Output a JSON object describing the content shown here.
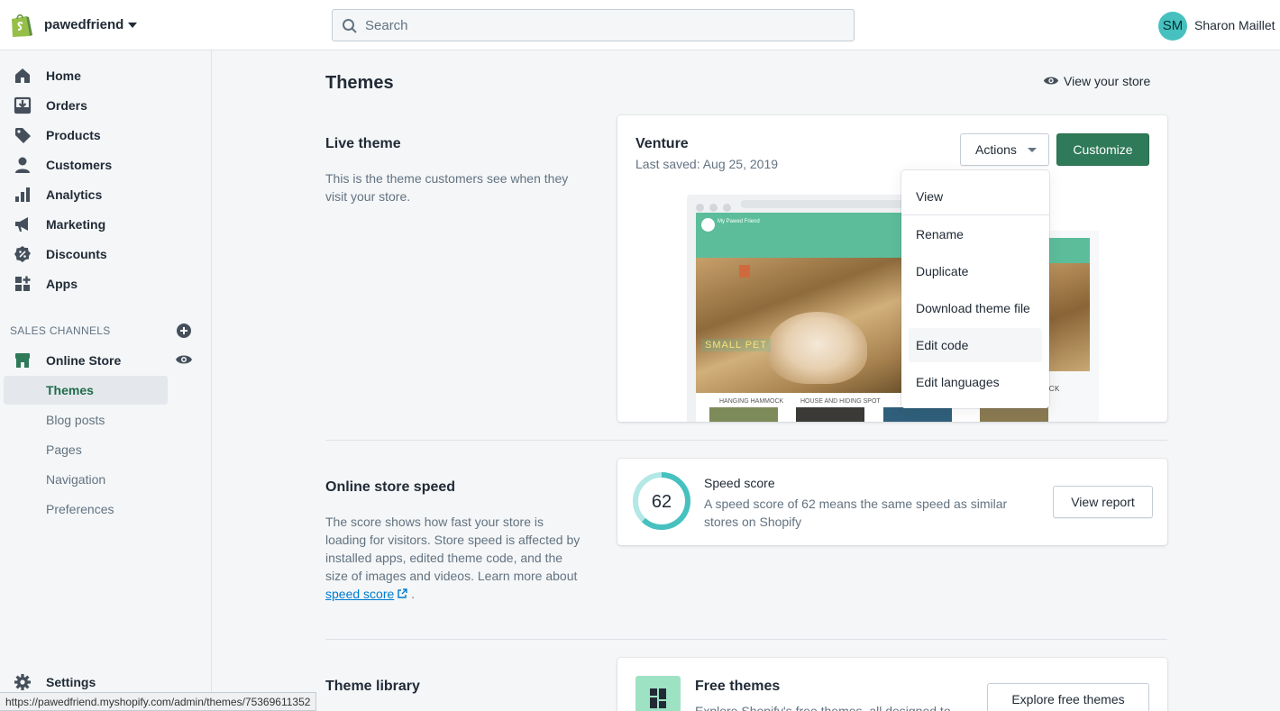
{
  "topbar": {
    "store_name": "pawedfriend",
    "search_placeholder": "Search",
    "user_initials": "SM",
    "user_name": "Sharon Maillet"
  },
  "sidebar": {
    "items": [
      {
        "label": "Home",
        "icon": "home-icon"
      },
      {
        "label": "Orders",
        "icon": "orders-icon"
      },
      {
        "label": "Products",
        "icon": "tag-icon"
      },
      {
        "label": "Customers",
        "icon": "person-icon"
      },
      {
        "label": "Analytics",
        "icon": "bar-chart-icon"
      },
      {
        "label": "Marketing",
        "icon": "megaphone-icon"
      },
      {
        "label": "Discounts",
        "icon": "discount-icon"
      },
      {
        "label": "Apps",
        "icon": "apps-icon"
      }
    ],
    "sales_channels_title": "SALES CHANNELS",
    "online_store": "Online Store",
    "sub_items": [
      "Themes",
      "Blog posts",
      "Pages",
      "Navigation",
      "Preferences"
    ],
    "settings": "Settings"
  },
  "status_url": "https://pawedfriend.myshopify.com/admin/themes/75369611352",
  "main": {
    "title": "Themes",
    "view_store": "View your store",
    "live_theme": {
      "heading": "Live theme",
      "description": "This is the theme customers see when they visit your store.",
      "theme_name": "Venture",
      "last_saved": "Last saved: Aug 25, 2019",
      "actions_label": "Actions",
      "customize_label": "Customize",
      "preview": {
        "store_title": "My Pawed Friend",
        "hero_caption": "SMALL PET",
        "categories": [
          "HANGING HAMMOCK",
          "HOUSE AND HIDING SPOT"
        ],
        "right_caption": "OCK"
      }
    },
    "actions_menu": {
      "items": [
        "View",
        "Rename",
        "Duplicate",
        "Download theme file",
        "Edit code",
        "Edit languages"
      ],
      "hovered": "Edit code"
    },
    "speed": {
      "heading": "Online store speed",
      "description_before": "The score shows how fast your store is loading for visitors. Store speed is affected by installed apps, edited theme code, and the size of images and videos. Learn more about ",
      "link_text": "speed score",
      "description_after": " .",
      "score": "62",
      "score_value": 62,
      "card_title": "Speed score",
      "card_desc": "A speed score of 62 means the same speed as similar stores on Shopify",
      "report_button": "View report"
    },
    "library": {
      "heading": "Theme library",
      "free_title": "Free themes",
      "free_desc": "Explore Shopify's free themes, all designed to",
      "explore_button": "Explore free themes"
    }
  },
  "colors": {
    "brand_green": "#2f7a58",
    "teal": "#47c1bf",
    "active_text": "#1f6b4a",
    "gauge": "#47c1bf"
  }
}
